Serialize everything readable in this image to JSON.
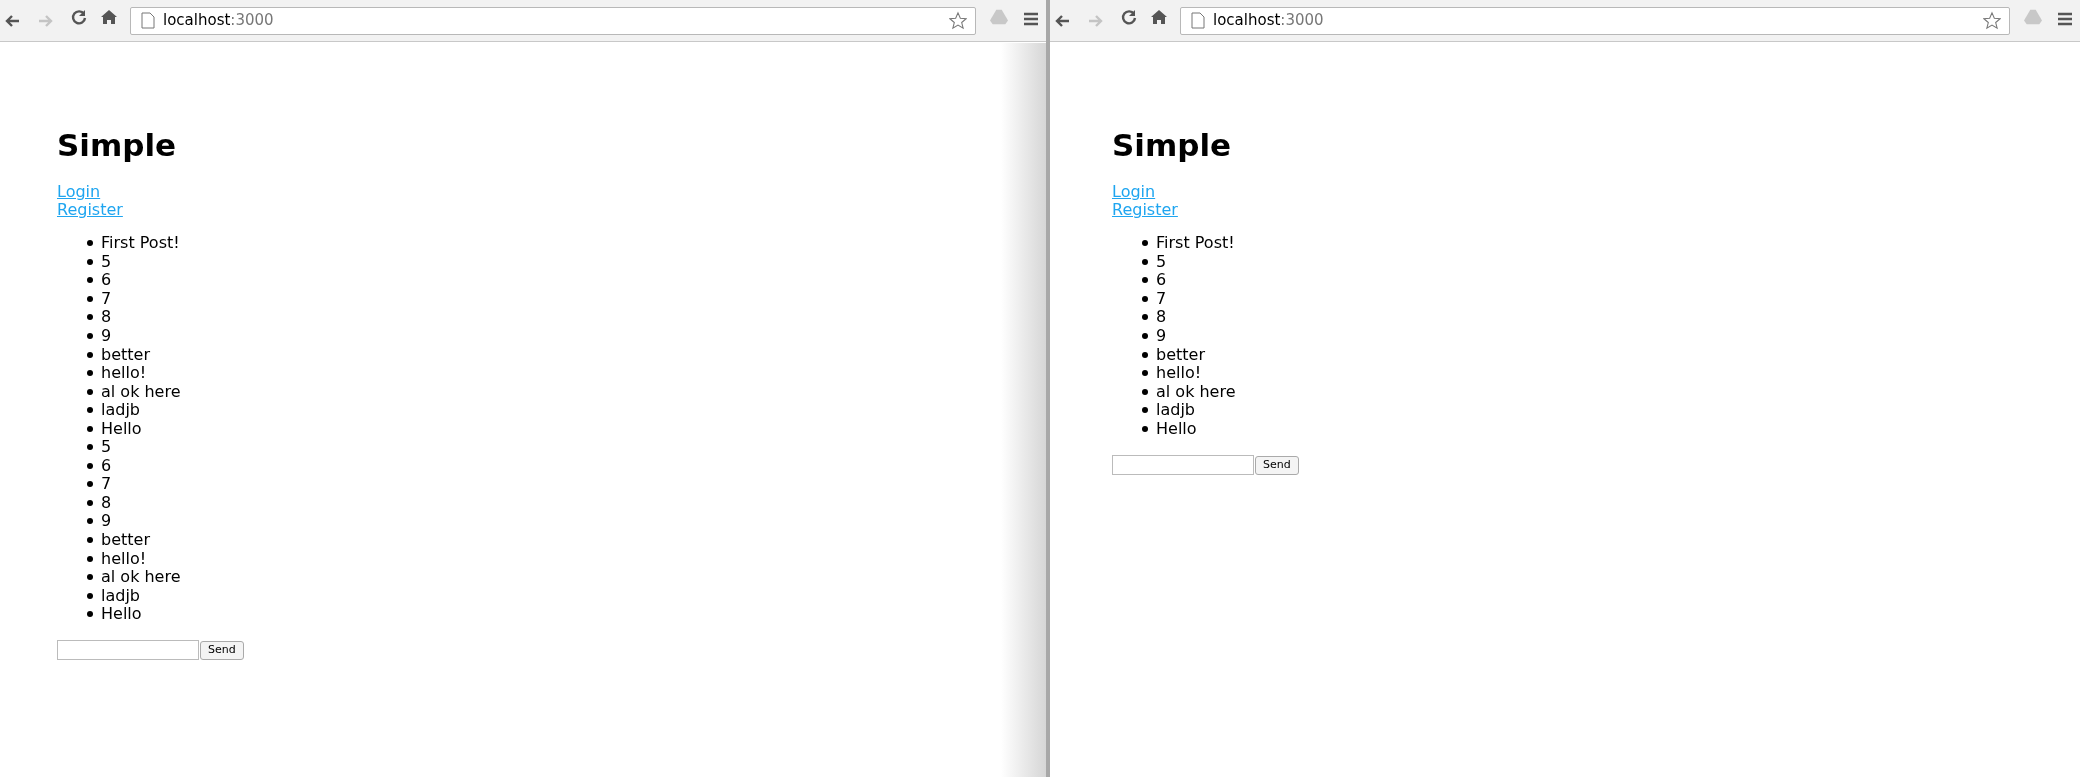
{
  "windows": [
    {
      "nav": {
        "back_disabled": false,
        "forward_disabled": true
      },
      "address": {
        "host": "localhost",
        "port": ":3000"
      },
      "title": "Simple",
      "links": [
        "Login",
        "Register"
      ],
      "posts": [
        "First Post!",
        "5",
        "6",
        "7",
        "8",
        "9",
        "better",
        "hello!",
        "al ok here",
        "ladjb",
        "Hello",
        "5",
        "6",
        "7",
        "8",
        "9",
        "better",
        "hello!",
        "al ok here",
        "ladjb",
        "Hello"
      ],
      "send_button": "Send"
    },
    {
      "nav": {
        "back_disabled": false,
        "forward_disabled": true
      },
      "address": {
        "host": "localhost",
        "port": ":3000"
      },
      "title": "Simple",
      "links": [
        "Login",
        "Register"
      ],
      "posts": [
        "First Post!",
        "5",
        "6",
        "7",
        "8",
        "9",
        "better",
        "hello!",
        "al ok here",
        "ladjb",
        "Hello"
      ],
      "send_button": "Send"
    }
  ]
}
